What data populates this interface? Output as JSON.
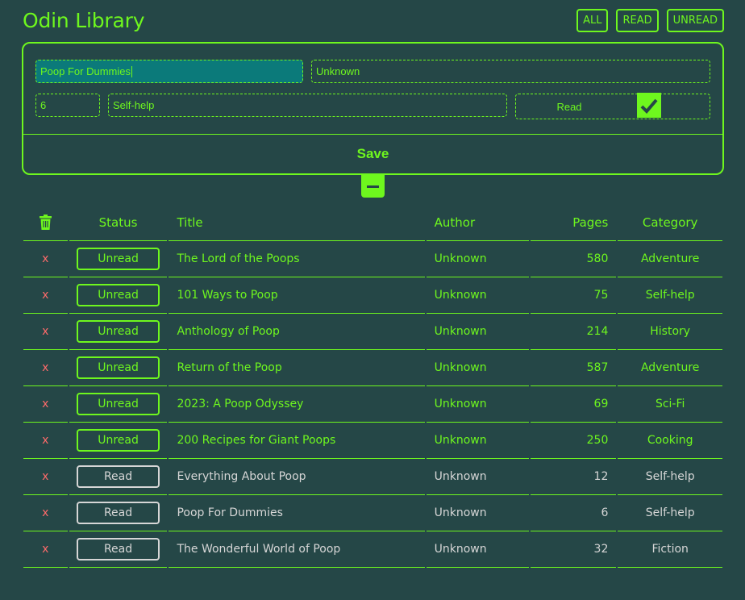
{
  "app": {
    "title": "Odin Library"
  },
  "filters": {
    "all": "ALL",
    "read": "READ",
    "unread": "UNREAD"
  },
  "form": {
    "title_value": "Poop For Dummies",
    "author_value": "Unknown",
    "pages_value": "6",
    "category_value": "Self-help",
    "read_label": "Read",
    "read_checked": true,
    "save_label": "Save"
  },
  "table": {
    "headers": {
      "status": "Status",
      "title": "Title",
      "author": "Author",
      "pages": "Pages",
      "category": "Category"
    },
    "delete_glyph": "x",
    "rows": [
      {
        "status": "Unread",
        "title": "The Lord of the Poops",
        "author": "Unknown",
        "pages": "580",
        "category": "Adventure"
      },
      {
        "status": "Unread",
        "title": "101 Ways to Poop",
        "author": "Unknown",
        "pages": "75",
        "category": "Self-help"
      },
      {
        "status": "Unread",
        "title": "Anthology of Poop",
        "author": "Unknown",
        "pages": "214",
        "category": "History"
      },
      {
        "status": "Unread",
        "title": "Return of the Poop",
        "author": "Unknown",
        "pages": "587",
        "category": "Adventure"
      },
      {
        "status": "Unread",
        "title": "2023: A Poop Odyssey",
        "author": "Unknown",
        "pages": "69",
        "category": "Sci-Fi"
      },
      {
        "status": "Unread",
        "title": "200 Recipes for Giant Poops",
        "author": "Unknown",
        "pages": "250",
        "category": "Cooking"
      },
      {
        "status": "Read",
        "title": "Everything About Poop",
        "author": "Unknown",
        "pages": "12",
        "category": "Self-help"
      },
      {
        "status": "Read",
        "title": "Poop For Dummies",
        "author": "Unknown",
        "pages": "6",
        "category": "Self-help"
      },
      {
        "status": "Read",
        "title": "The Wonderful World of Poop",
        "author": "Unknown",
        "pages": "32",
        "category": "Fiction"
      }
    ]
  },
  "colors": {
    "background": "#254747",
    "accent": "#6ef71e",
    "read_text": "#d6d6d6",
    "delete": "#ff6b6b",
    "active_input": "#0b7a7a"
  },
  "icons": {
    "trash": "trash-icon",
    "checkmark": "checkmark-icon",
    "collapse": "minus-icon"
  }
}
